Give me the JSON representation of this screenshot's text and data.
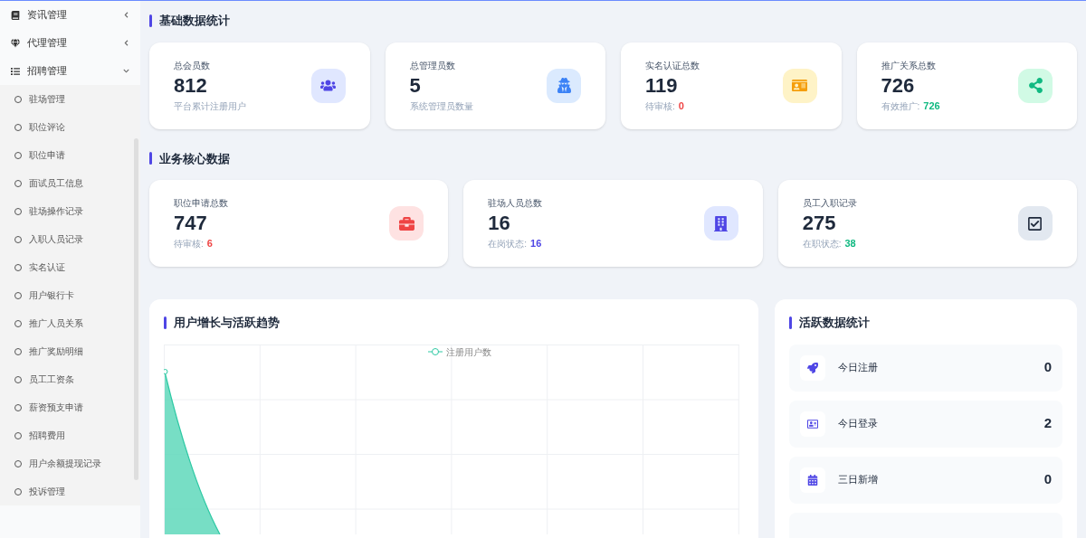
{
  "sidebar": {
    "items": [
      {
        "label": "资讯管理",
        "expanded": false
      },
      {
        "label": "代理管理",
        "expanded": false
      },
      {
        "label": "招聘管理",
        "expanded": true,
        "children": [
          {
            "label": "驻场管理"
          },
          {
            "label": "职位评论"
          },
          {
            "label": "职位申请"
          },
          {
            "label": "面试员工信息"
          },
          {
            "label": "驻场操作记录"
          },
          {
            "label": "入职人员记录"
          },
          {
            "label": "实名认证"
          },
          {
            "label": "用户银行卡"
          },
          {
            "label": "推广人员关系"
          },
          {
            "label": "推广奖励明细"
          },
          {
            "label": "员工工资条"
          },
          {
            "label": "薪资预支申请"
          },
          {
            "label": "招聘费用"
          },
          {
            "label": "用户余额提现记录"
          },
          {
            "label": "投诉管理"
          }
        ]
      }
    ]
  },
  "sections": [
    {
      "title": "基础数据统计",
      "stats": [
        {
          "label": "总会员数",
          "value": "812",
          "note": "平台累计注册用户"
        },
        {
          "label": "总管理员数",
          "value": "5",
          "note": "系统管理员数量"
        },
        {
          "label": "实名认证总数",
          "value": "119",
          "note": "待审核:",
          "highlight": "0",
          "color": "#ef4444"
        },
        {
          "label": "推广关系总数",
          "value": "726",
          "note": "有效推广:",
          "highlight": "726",
          "color": "#10b981"
        }
      ]
    },
    {
      "title": "业务核心数据",
      "stats": [
        {
          "label": "职位申请总数",
          "value": "747",
          "note": "待审核:",
          "highlight": "6",
          "color": "#ef4444"
        },
        {
          "label": "驻场人员总数",
          "value": "16",
          "note": "在岗状态:",
          "highlight": "16",
          "color": "#4f46e5"
        },
        {
          "label": "员工入职记录",
          "value": "275",
          "note": "在职状态:",
          "highlight": "38",
          "color": "#10b981"
        }
      ]
    }
  ],
  "trend": {
    "title": "用户增长与活跃趋势",
    "legend": "注册用户数"
  },
  "activity": {
    "title": "活跃数据统计",
    "items": [
      {
        "label": "今日注册",
        "value": "0"
      },
      {
        "label": "今日登录",
        "value": "2"
      },
      {
        "label": "三日新增",
        "value": "0"
      }
    ]
  }
}
